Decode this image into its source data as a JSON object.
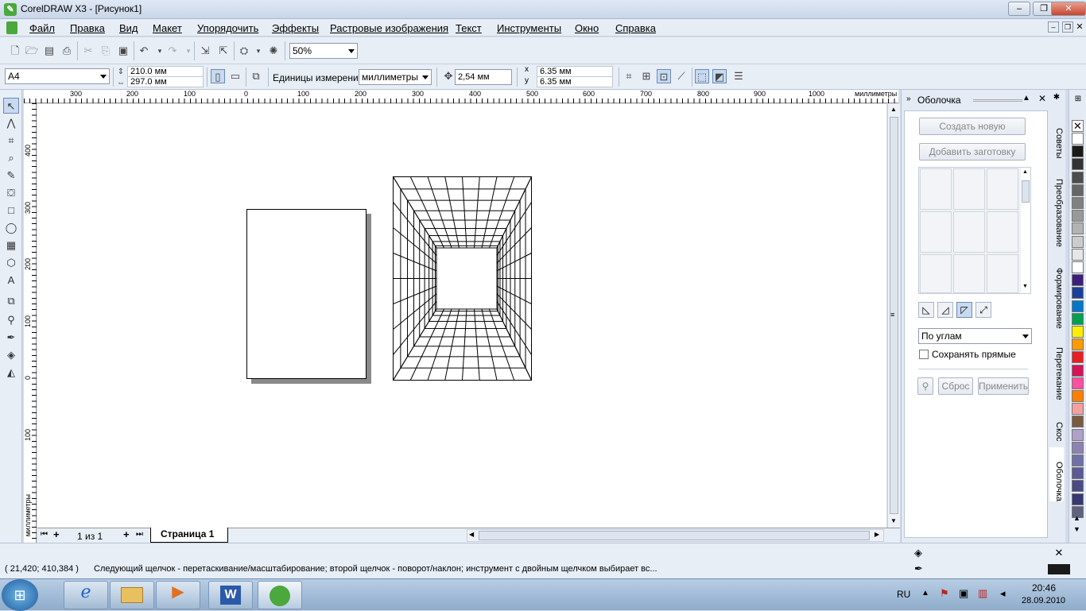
{
  "window": {
    "title": "CorelDRAW X3 - [Рисунок1]",
    "minimize": "–",
    "restore": "❐",
    "close": "✕"
  },
  "menu": [
    "Файл",
    "Правка",
    "Вид",
    "Макет",
    "Упорядочить",
    "Эффекты",
    "Растровые изображения",
    "Текст",
    "Инструменты",
    "Окно",
    "Справка"
  ],
  "toolbar": {
    "zoom": "50%"
  },
  "property_bar": {
    "page_size": "A4",
    "width": "210.0 мм",
    "height": "297.0 мм",
    "units_label": "Единицы измерения:",
    "units_value": "миллиметры",
    "nudge": "2,54 мм",
    "dup_x": "6.35 мм",
    "dup_y": "6.35 мм",
    "x_label": "x",
    "y_label": "y"
  },
  "ruler": {
    "top_ticks": [
      "300",
      "200",
      "100",
      "0",
      "100",
      "200",
      "300",
      "400",
      "500",
      "600",
      "700",
      "800",
      "900",
      "1000"
    ],
    "top_unit": "миллиметры",
    "left_ticks": [
      "400",
      "300",
      "200",
      "100",
      "0",
      "100"
    ],
    "left_unit": "миллиметры"
  },
  "page_nav": {
    "counter": "1 из 1",
    "tab": "Страница 1"
  },
  "docker": {
    "title": "Оболочка",
    "btn_new": "Создать новую",
    "btn_preset": "Добавить заготовку",
    "mode_value": "По углам",
    "keep_lines": "Сохранять прямые",
    "btn_reset": "Сброс",
    "btn_apply": "Применить"
  },
  "docker_tabs": [
    "Советы",
    "Преобразование",
    "Формирование",
    "Перетекание",
    "Скос",
    "Оболочка"
  ],
  "palette": [
    "#ffffff",
    "#1a1a1a",
    "#333333",
    "#4d4d4d",
    "#666666",
    "#808080",
    "#999999",
    "#b3b3b3",
    "#cccccc",
    "#e6e6e6",
    "#ffffff",
    "#3c1f7a",
    "#1c3f9a",
    "#0077c8",
    "#00a050",
    "#ffee00",
    "#ff9900",
    "#e62020",
    "#d4145a",
    "#ff4fa0",
    "#ff8000",
    "#f5a0a0",
    "#7a5a40",
    "#b0a0c8",
    "#8c82b4",
    "#7070a8",
    "#5a5a96",
    "#4a4a84",
    "#383872",
    "#606080"
  ],
  "status": {
    "coords": "( 21,420; 410,384 )",
    "message": "Следующий щелчок - перетаскивание/масштабирование; второй щелчок - поворот/наклон; инструмент с двойным щелчком выбирает вс..."
  },
  "taskbar": {
    "lang": "RU",
    "time": "20:46",
    "date": "28.09.2010"
  }
}
